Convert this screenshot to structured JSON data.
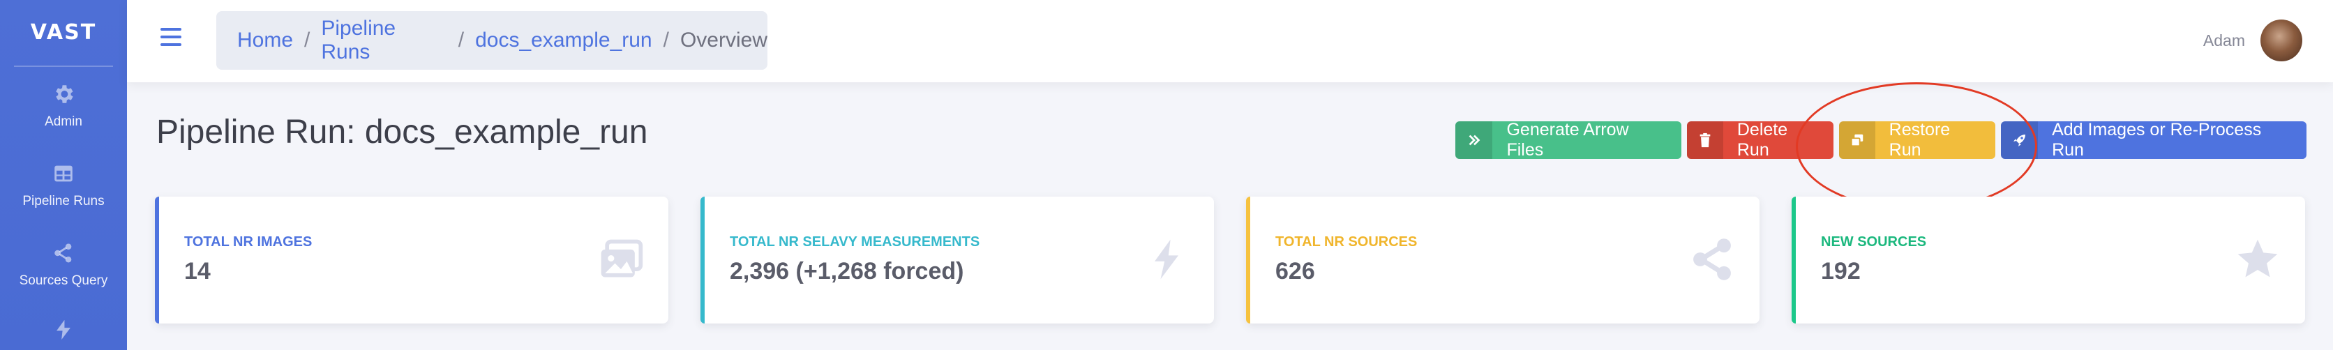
{
  "sidebar": {
    "brand": "VAST",
    "items": [
      {
        "label": "Admin",
        "icon": "gear-icon"
      },
      {
        "label": "Pipeline Runs",
        "icon": "table-icon"
      },
      {
        "label": "Sources Query",
        "icon": "share-icon"
      },
      {
        "label": "",
        "icon": "bolt-icon"
      }
    ]
  },
  "topbar": {
    "breadcrumb": [
      "Home",
      "Pipeline Runs",
      "docs_example_run",
      "Overview"
    ],
    "user_name": "Adam"
  },
  "page": {
    "title": "Pipeline Run: docs_example_run"
  },
  "actions": {
    "generate_arrow": "Generate Arrow Files",
    "delete_run": "Delete Run",
    "restore_run": "Restore Run",
    "add_images": "Add Images or Re-Process Run"
  },
  "cards": [
    {
      "label": "Total Nr Images",
      "value": "14",
      "icon": "images-icon"
    },
    {
      "label": "Total Nr Selavy Measurements",
      "value": "2,396 (+1,268 forced)",
      "icon": "bolt-icon"
    },
    {
      "label": "Total Nr Sources",
      "value": "626",
      "icon": "share-icon"
    },
    {
      "label": "New Sources",
      "value": "192",
      "icon": "star-icon"
    }
  ],
  "colors": {
    "primary": "#4e73df",
    "success": "#48c08a",
    "danger": "#e0493a",
    "warning": "#f2bd3c",
    "info": "#36b9cc",
    "annotation": "#e23a24"
  }
}
